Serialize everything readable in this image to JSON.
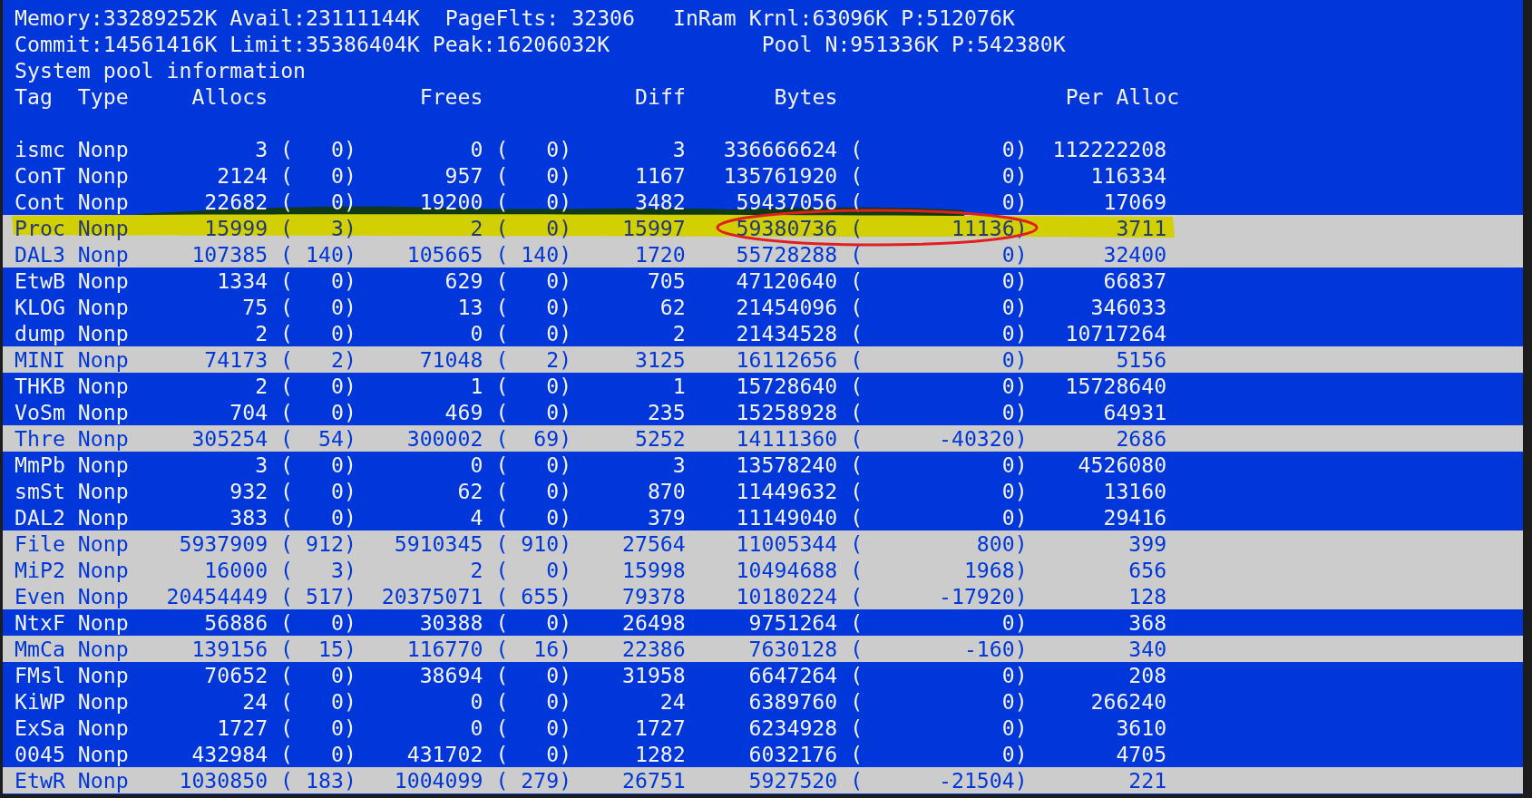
{
  "stats_lines": [
    "Memory:33289252K Avail:23111144K  PageFlts: 32306   InRam Krnl:63096K P:512076K",
    "Commit:14561416K Limit:35386404K Peak:16206032K            Pool N:951336K P:542380K"
  ],
  "title": "System pool information",
  "columns": [
    "Tag",
    "Type",
    "Allocs",
    "Frees",
    "Diff",
    "Bytes",
    "Per Alloc"
  ],
  "rows": [
    {
      "tag": "ismc",
      "type": "Nonp",
      "allocs": "3",
      "allocs_change": "(   0)",
      "frees": "0",
      "frees_change": "(   0)",
      "diff": "3",
      "bytes": "336666624",
      "bytes_change": "(           0)",
      "per_alloc": "112222208",
      "changed": false
    },
    {
      "tag": "ConT",
      "type": "Nonp",
      "allocs": "2124",
      "allocs_change": "(   0)",
      "frees": "957",
      "frees_change": "(   0)",
      "diff": "1167",
      "bytes": "135761920",
      "bytes_change": "(           0)",
      "per_alloc": "116334",
      "changed": false
    },
    {
      "tag": "Cont",
      "type": "Nonp",
      "allocs": "22682",
      "allocs_change": "(   0)",
      "frees": "19200",
      "frees_change": "(   0)",
      "diff": "3482",
      "bytes": "59437056",
      "bytes_change": "(           0)",
      "per_alloc": "17069",
      "changed": false
    },
    {
      "tag": "Proc",
      "type": "Nonp",
      "allocs": "15999",
      "allocs_change": "(   3)",
      "frees": "2",
      "frees_change": "(   0)",
      "diff": "15997",
      "bytes": "59380736",
      "bytes_change": "(       11136)",
      "per_alloc": "3711",
      "changed": true,
      "highlighted": true,
      "circled": true
    },
    {
      "tag": "DAL3",
      "type": "Nonp",
      "allocs": "107385",
      "allocs_change": "( 140)",
      "frees": "105665",
      "frees_change": "( 140)",
      "diff": "1720",
      "bytes": "55728288",
      "bytes_change": "(           0)",
      "per_alloc": "32400",
      "changed": true
    },
    {
      "tag": "EtwB",
      "type": "Nonp",
      "allocs": "1334",
      "allocs_change": "(   0)",
      "frees": "629",
      "frees_change": "(   0)",
      "diff": "705",
      "bytes": "47120640",
      "bytes_change": "(           0)",
      "per_alloc": "66837",
      "changed": false
    },
    {
      "tag": "KLOG",
      "type": "Nonp",
      "allocs": "75",
      "allocs_change": "(   0)",
      "frees": "13",
      "frees_change": "(   0)",
      "diff": "62",
      "bytes": "21454096",
      "bytes_change": "(           0)",
      "per_alloc": "346033",
      "changed": false
    },
    {
      "tag": "dump",
      "type": "Nonp",
      "allocs": "2",
      "allocs_change": "(   0)",
      "frees": "0",
      "frees_change": "(   0)",
      "diff": "2",
      "bytes": "21434528",
      "bytes_change": "(           0)",
      "per_alloc": "10717264",
      "changed": false
    },
    {
      "tag": "MINI",
      "type": "Nonp",
      "allocs": "74173",
      "allocs_change": "(   2)",
      "frees": "71048",
      "frees_change": "(   2)",
      "diff": "3125",
      "bytes": "16112656",
      "bytes_change": "(           0)",
      "per_alloc": "5156",
      "changed": true
    },
    {
      "tag": "THKB",
      "type": "Nonp",
      "allocs": "2",
      "allocs_change": "(   0)",
      "frees": "1",
      "frees_change": "(   0)",
      "diff": "1",
      "bytes": "15728640",
      "bytes_change": "(           0)",
      "per_alloc": "15728640",
      "changed": false
    },
    {
      "tag": "VoSm",
      "type": "Nonp",
      "allocs": "704",
      "allocs_change": "(   0)",
      "frees": "469",
      "frees_change": "(   0)",
      "diff": "235",
      "bytes": "15258928",
      "bytes_change": "(           0)",
      "per_alloc": "64931",
      "changed": false
    },
    {
      "tag": "Thre",
      "type": "Nonp",
      "allocs": "305254",
      "allocs_change": "(  54)",
      "frees": "300002",
      "frees_change": "(  69)",
      "diff": "5252",
      "bytes": "14111360",
      "bytes_change": "(      -40320)",
      "per_alloc": "2686",
      "changed": true
    },
    {
      "tag": "MmPb",
      "type": "Nonp",
      "allocs": "3",
      "allocs_change": "(   0)",
      "frees": "0",
      "frees_change": "(   0)",
      "diff": "3",
      "bytes": "13578240",
      "bytes_change": "(           0)",
      "per_alloc": "4526080",
      "changed": false
    },
    {
      "tag": "smSt",
      "type": "Nonp",
      "allocs": "932",
      "allocs_change": "(   0)",
      "frees": "62",
      "frees_change": "(   0)",
      "diff": "870",
      "bytes": "11449632",
      "bytes_change": "(           0)",
      "per_alloc": "13160",
      "changed": false
    },
    {
      "tag": "DAL2",
      "type": "Nonp",
      "allocs": "383",
      "allocs_change": "(   0)",
      "frees": "4",
      "frees_change": "(   0)",
      "diff": "379",
      "bytes": "11149040",
      "bytes_change": "(           0)",
      "per_alloc": "29416",
      "changed": false
    },
    {
      "tag": "File",
      "type": "Nonp",
      "allocs": "5937909",
      "allocs_change": "( 912)",
      "frees": "5910345",
      "frees_change": "( 910)",
      "diff": "27564",
      "bytes": "11005344",
      "bytes_change": "(         800)",
      "per_alloc": "399",
      "changed": true
    },
    {
      "tag": "MiP2",
      "type": "Nonp",
      "allocs": "16000",
      "allocs_change": "(   3)",
      "frees": "2",
      "frees_change": "(   0)",
      "diff": "15998",
      "bytes": "10494688",
      "bytes_change": "(        1968)",
      "per_alloc": "656",
      "changed": true
    },
    {
      "tag": "Even",
      "type": "Nonp",
      "allocs": "20454449",
      "allocs_change": "( 517)",
      "frees": "20375071",
      "frees_change": "( 655)",
      "diff": "79378",
      "bytes": "10180224",
      "bytes_change": "(      -17920)",
      "per_alloc": "128",
      "changed": true
    },
    {
      "tag": "NtxF",
      "type": "Nonp",
      "allocs": "56886",
      "allocs_change": "(   0)",
      "frees": "30388",
      "frees_change": "(   0)",
      "diff": "26498",
      "bytes": "9751264",
      "bytes_change": "(           0)",
      "per_alloc": "368",
      "changed": false
    },
    {
      "tag": "MmCa",
      "type": "Nonp",
      "allocs": "139156",
      "allocs_change": "(  15)",
      "frees": "116770",
      "frees_change": "(  16)",
      "diff": "22386",
      "bytes": "7630128",
      "bytes_change": "(        -160)",
      "per_alloc": "340",
      "changed": true
    },
    {
      "tag": "FMsl",
      "type": "Nonp",
      "allocs": "70652",
      "allocs_change": "(   0)",
      "frees": "38694",
      "frees_change": "(   0)",
      "diff": "31958",
      "bytes": "6647264",
      "bytes_change": "(           0)",
      "per_alloc": "208",
      "changed": false
    },
    {
      "tag": "KiWP",
      "type": "Nonp",
      "allocs": "24",
      "allocs_change": "(   0)",
      "frees": "0",
      "frees_change": "(   0)",
      "diff": "24",
      "bytes": "6389760",
      "bytes_change": "(           0)",
      "per_alloc": "266240",
      "changed": false
    },
    {
      "tag": "ExSa",
      "type": "Nonp",
      "allocs": "1727",
      "allocs_change": "(   0)",
      "frees": "0",
      "frees_change": "(   0)",
      "diff": "1727",
      "bytes": "6234928",
      "bytes_change": "(           0)",
      "per_alloc": "3610",
      "changed": false
    },
    {
      "tag": "0045",
      "type": "Nonp",
      "allocs": "432984",
      "allocs_change": "(   0)",
      "frees": "431702",
      "frees_change": "(   0)",
      "diff": "1282",
      "bytes": "6032176",
      "bytes_change": "(           0)",
      "per_alloc": "4705",
      "changed": false
    },
    {
      "tag": "EtwR",
      "type": "Nonp",
      "allocs": "1030850",
      "allocs_change": "( 183)",
      "frees": "1004099",
      "frees_change": "( 279)",
      "diff": "26751",
      "bytes": "5927520",
      "bytes_change": "(      -21504)",
      "per_alloc": "221",
      "changed": true
    }
  ]
}
